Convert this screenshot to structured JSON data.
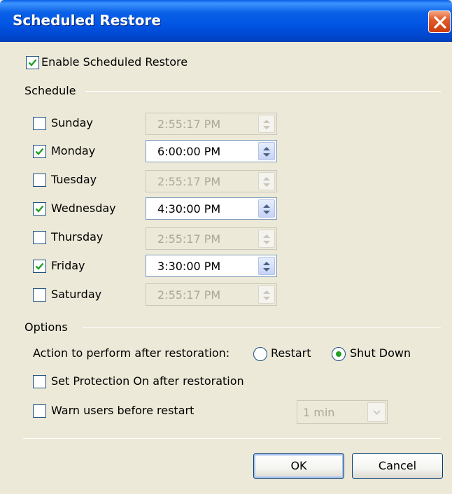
{
  "window": {
    "title": "Scheduled Restore"
  },
  "enable": {
    "label": "Enable Scheduled Restore",
    "checked": true
  },
  "schedule": {
    "heading": "Schedule",
    "days": [
      {
        "label": "Sunday",
        "checked": false,
        "time": "2:55:17 PM"
      },
      {
        "label": "Monday",
        "checked": true,
        "time": "6:00:00 PM"
      },
      {
        "label": "Tuesday",
        "checked": false,
        "time": "2:55:17 PM"
      },
      {
        "label": "Wednesday",
        "checked": true,
        "time": "4:30:00 PM"
      },
      {
        "label": "Thursday",
        "checked": false,
        "time": "2:55:17 PM"
      },
      {
        "label": "Friday",
        "checked": true,
        "time": "3:30:00 PM"
      },
      {
        "label": "Saturday",
        "checked": false,
        "time": "2:55:17 PM"
      }
    ]
  },
  "options": {
    "heading": "Options",
    "action_label": "Action to perform after restoration:",
    "restart_label": "Restart",
    "shutdown_label": "Shut Down",
    "selected_action": "Shut Down",
    "protection_label": "Set Protection On after restoration",
    "protection_checked": false,
    "warn_label": "Warn users before restart",
    "warn_checked": false,
    "warn_delay": "1 min"
  },
  "buttons": {
    "ok": "OK",
    "cancel": "Cancel"
  },
  "colors": {
    "titlebar": "#0054e3",
    "check": "#21a121",
    "face": "#ece9d8"
  }
}
